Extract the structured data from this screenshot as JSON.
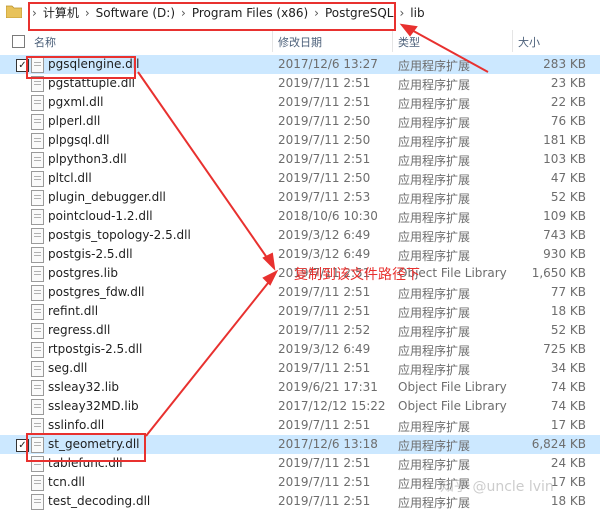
{
  "address_bar": {
    "crumbs": [
      "计算机",
      "Software (D:)",
      "Program Files (x86)",
      "PostgreSQL",
      "lib"
    ]
  },
  "columns": {
    "name": "名称",
    "date": "修改日期",
    "type": "类型",
    "size": "大小"
  },
  "files": [
    {
      "name": "pgsqlengine.dll",
      "date": "2017/12/6 13:27",
      "type": "应用程序扩展",
      "size": "283 KB",
      "selected": true
    },
    {
      "name": "pgstattuple.dll",
      "date": "2019/7/11 2:51",
      "type": "应用程序扩展",
      "size": "23 KB",
      "selected": false
    },
    {
      "name": "pgxml.dll",
      "date": "2019/7/11 2:51",
      "type": "应用程序扩展",
      "size": "22 KB",
      "selected": false
    },
    {
      "name": "plperl.dll",
      "date": "2019/7/11 2:50",
      "type": "应用程序扩展",
      "size": "76 KB",
      "selected": false
    },
    {
      "name": "plpgsql.dll",
      "date": "2019/7/11 2:50",
      "type": "应用程序扩展",
      "size": "181 KB",
      "selected": false
    },
    {
      "name": "plpython3.dll",
      "date": "2019/7/11 2:51",
      "type": "应用程序扩展",
      "size": "103 KB",
      "selected": false
    },
    {
      "name": "pltcl.dll",
      "date": "2019/7/11 2:50",
      "type": "应用程序扩展",
      "size": "47 KB",
      "selected": false
    },
    {
      "name": "plugin_debugger.dll",
      "date": "2019/7/11 2:53",
      "type": "应用程序扩展",
      "size": "52 KB",
      "selected": false
    },
    {
      "name": "pointcloud-1.2.dll",
      "date": "2018/10/6 10:30",
      "type": "应用程序扩展",
      "size": "109 KB",
      "selected": false
    },
    {
      "name": "postgis_topology-2.5.dll",
      "date": "2019/3/12 6:49",
      "type": "应用程序扩展",
      "size": "743 KB",
      "selected": false
    },
    {
      "name": "postgis-2.5.dll",
      "date": "2019/3/12 6:49",
      "type": "应用程序扩展",
      "size": "930 KB",
      "selected": false
    },
    {
      "name": "postgres.lib",
      "date": "2019/7/11 2:51",
      "type": "Object File Library",
      "size": "1,650 KB",
      "selected": false
    },
    {
      "name": "postgres_fdw.dll",
      "date": "2019/7/11 2:51",
      "type": "应用程序扩展",
      "size": "77 KB",
      "selected": false
    },
    {
      "name": "refint.dll",
      "date": "2019/7/11 2:51",
      "type": "应用程序扩展",
      "size": "18 KB",
      "selected": false
    },
    {
      "name": "regress.dll",
      "date": "2019/7/11 2:52",
      "type": "应用程序扩展",
      "size": "52 KB",
      "selected": false
    },
    {
      "name": "rtpostgis-2.5.dll",
      "date": "2019/3/12 6:49",
      "type": "应用程序扩展",
      "size": "725 KB",
      "selected": false
    },
    {
      "name": "seg.dll",
      "date": "2019/7/11 2:51",
      "type": "应用程序扩展",
      "size": "34 KB",
      "selected": false
    },
    {
      "name": "ssleay32.lib",
      "date": "2019/6/21 17:31",
      "type": "Object File Library",
      "size": "74 KB",
      "selected": false
    },
    {
      "name": "ssleay32MD.lib",
      "date": "2017/12/12 15:22",
      "type": "Object File Library",
      "size": "74 KB",
      "selected": false
    },
    {
      "name": "sslinfo.dll",
      "date": "2019/7/11 2:51",
      "type": "应用程序扩展",
      "size": "17 KB",
      "selected": false
    },
    {
      "name": "st_geometry.dll",
      "date": "2017/12/6 13:18",
      "type": "应用程序扩展",
      "size": "6,824 KB",
      "selected": true
    },
    {
      "name": "tablefunc.dll",
      "date": "2019/7/11 2:51",
      "type": "应用程序扩展",
      "size": "24 KB",
      "selected": false
    },
    {
      "name": "tcn.dll",
      "date": "2019/7/11 2:51",
      "type": "应用程序扩展",
      "size": "17 KB",
      "selected": false
    },
    {
      "name": "test_decoding.dll",
      "date": "2019/7/11 2:51",
      "type": "应用程序扩展",
      "size": "18 KB",
      "selected": false
    }
  ],
  "annotation": {
    "text": "复制到该文件路径下",
    "color": "#e8312f"
  },
  "watermark": "知乎 @uncle lvin"
}
